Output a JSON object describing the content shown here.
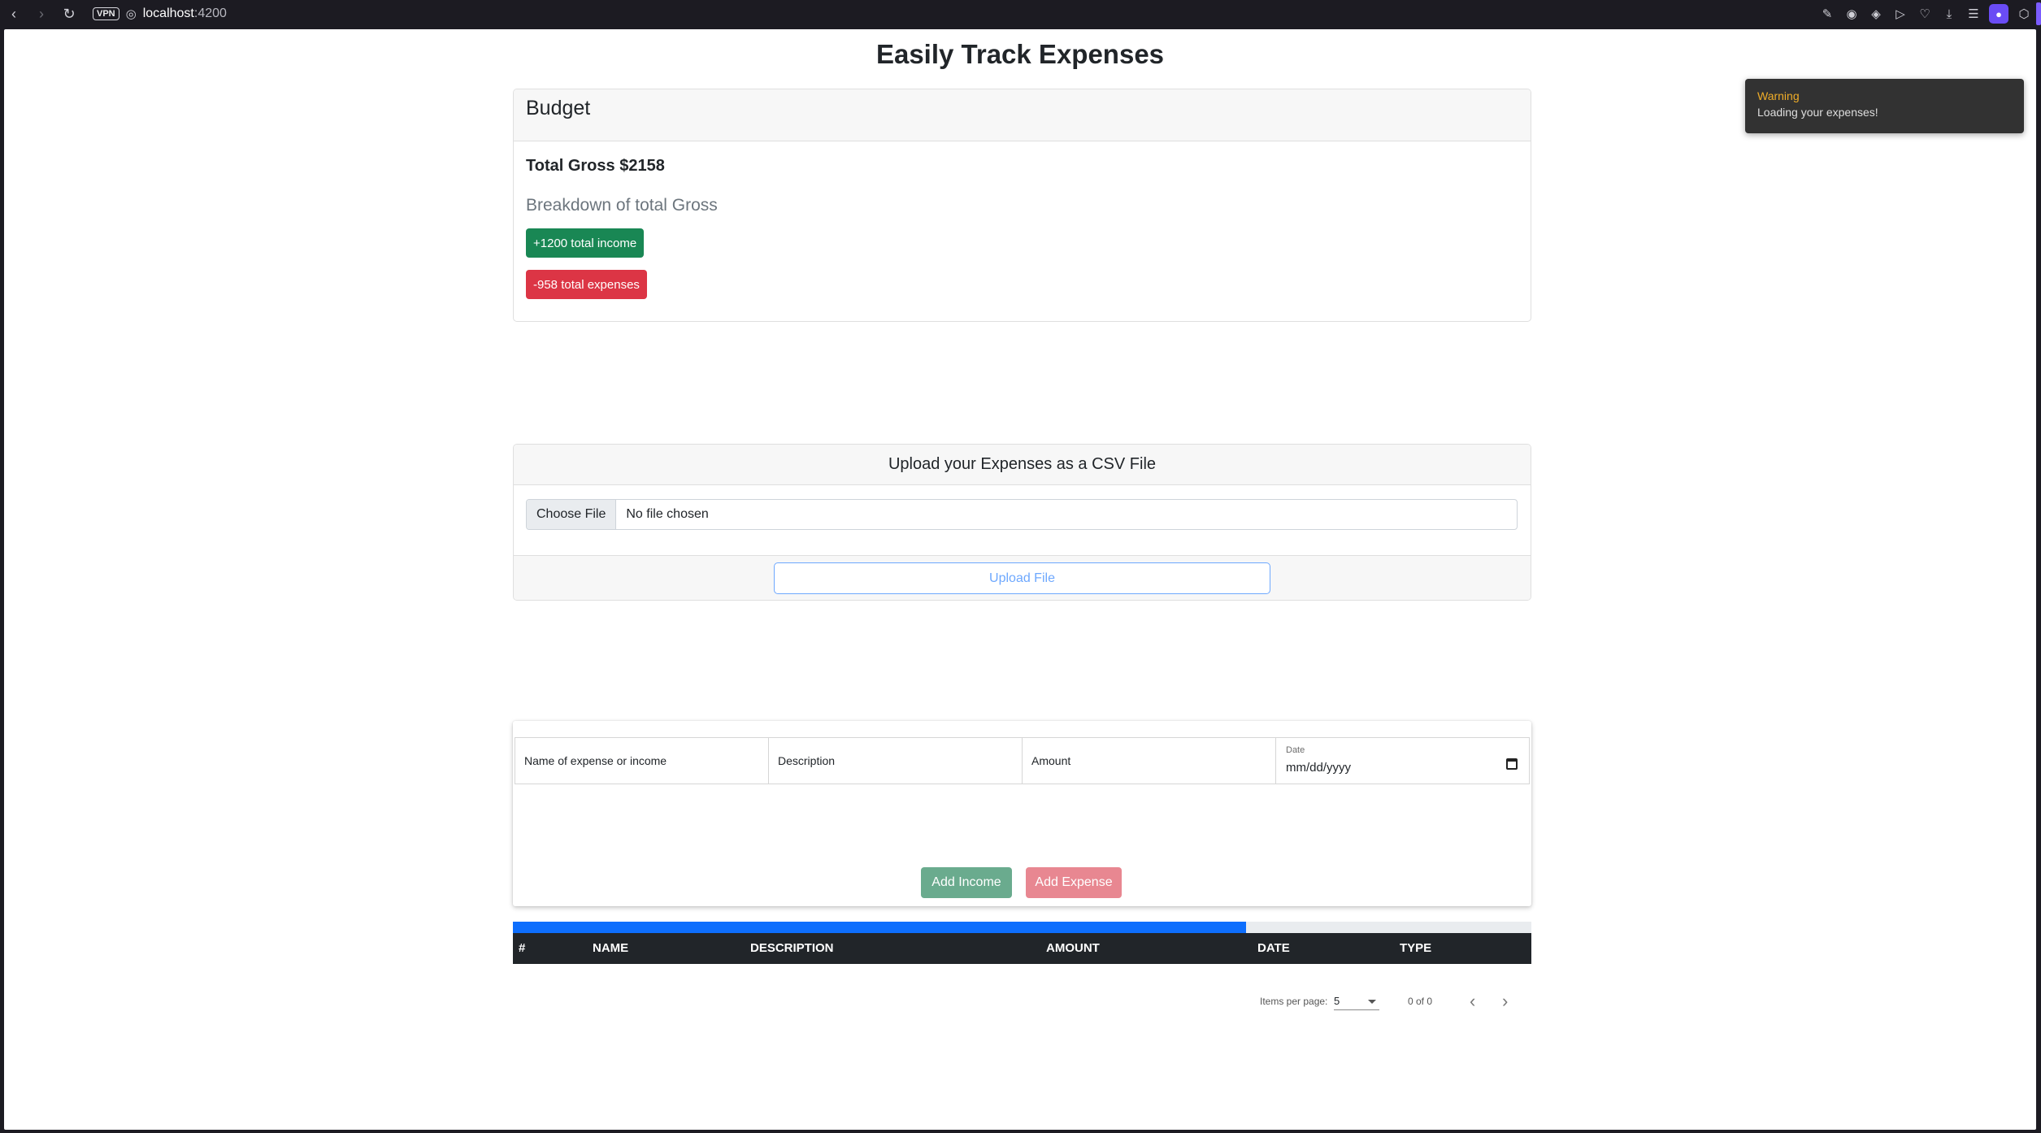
{
  "browser": {
    "vpn_label": "VPN",
    "url_host": "localhost",
    "url_port": ":4200"
  },
  "page": {
    "title": "Easily Track Expenses"
  },
  "budget": {
    "header": "Budget",
    "total_gross": "Total Gross $2158",
    "breakdown_title": "Breakdown of total Gross",
    "income_badge": "+1200 total income",
    "expense_badge": "-958 total expenses"
  },
  "upload": {
    "header": "Upload your Expenses as a CSV File",
    "choose_file_label": "Choose File",
    "no_file_text": "No file chosen",
    "upload_button": "Upload File"
  },
  "entry_form": {
    "name_placeholder": "Name of expense or income",
    "description_placeholder": "Description",
    "amount_placeholder": "Amount",
    "date_label": "Date",
    "date_value": "mm/dd/yyyy",
    "add_income_button": "Add Income",
    "add_expense_button": "Add Expense"
  },
  "table": {
    "progress_fraction": 0.72,
    "columns": [
      "#",
      "NAME",
      "DESCRIPTION",
      "AMOUNT",
      "DATE",
      "TYPE"
    ],
    "rows": []
  },
  "paginator": {
    "items_per_page_label": "Items per page:",
    "items_per_page_value": "5",
    "range_label": "0 of 0"
  },
  "toast": {
    "title": "Warning",
    "message": "Loading your expenses!"
  },
  "colors": {
    "income": "#198754",
    "expense": "#dc3545",
    "primary": "#0d6efd",
    "toast_title": "#f0ad28"
  }
}
